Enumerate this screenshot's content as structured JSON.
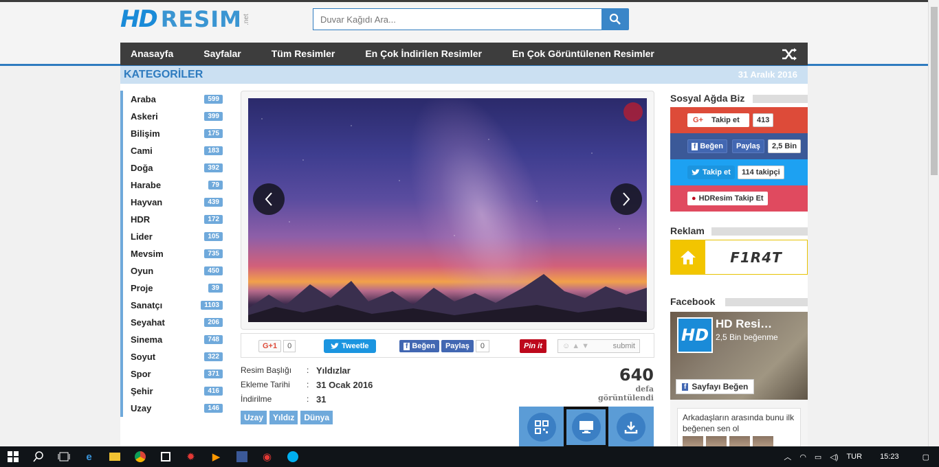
{
  "header": {
    "logo_hd": "HD",
    "logo_text": "RESIM",
    "logo_net": ".net",
    "search_placeholder": "Duvar Kağıdı Ara..."
  },
  "nav": {
    "items": [
      "Anasayfa",
      "Sayfalar",
      "Tüm Resimler",
      "En Çok İndirilen Resimler",
      "En Çok Görüntülenen Resimler"
    ]
  },
  "catbar": {
    "title": "KATEGORİLER",
    "date": "31 Aralık 2016"
  },
  "categories": [
    {
      "name": "Araba",
      "count": "599"
    },
    {
      "name": "Askeri",
      "count": "399"
    },
    {
      "name": "Bilişim",
      "count": "175"
    },
    {
      "name": "Cami",
      "count": "183"
    },
    {
      "name": "Doğa",
      "count": "392"
    },
    {
      "name": "Harabe",
      "count": "79"
    },
    {
      "name": "Hayvan",
      "count": "439"
    },
    {
      "name": "HDR",
      "count": "172"
    },
    {
      "name": "Lider",
      "count": "105"
    },
    {
      "name": "Mevsim",
      "count": "735"
    },
    {
      "name": "Oyun",
      "count": "450"
    },
    {
      "name": "Proje",
      "count": "39"
    },
    {
      "name": "Sanatçı",
      "count": "1103"
    },
    {
      "name": "Seyahat",
      "count": "206"
    },
    {
      "name": "Sinema",
      "count": "748"
    },
    {
      "name": "Soyut",
      "count": "322"
    },
    {
      "name": "Spor",
      "count": "371"
    },
    {
      "name": "Şehir",
      "count": "416"
    },
    {
      "name": "Uzay",
      "count": "146"
    }
  ],
  "share": {
    "gplus": "G+1",
    "gplus_count": "0",
    "tweet": "Tweetle",
    "fb_like": "Beğen",
    "fb_share": "Paylaş",
    "fb_count": "0",
    "pinit": "Pin it",
    "reddit": "submit"
  },
  "info": {
    "rows": [
      {
        "label": "Resim Başlığı",
        "sep": ":",
        "value": "Yıldızlar"
      },
      {
        "label": "Ekleme Tarihi",
        "sep": ":",
        "value": "31 Ocak 2016"
      },
      {
        "label": "İndirilme",
        "sep": ":",
        "value": "31"
      }
    ],
    "tags": [
      "Uzay",
      "Yıldız",
      "Dünya"
    ],
    "views": "640",
    "views_label": "defa görüntülendi"
  },
  "right": {
    "social_title": "Sosyal Ağda Biz",
    "gplus_btn": "Takip et",
    "gplus_icon": "G+",
    "gplus_count": "413",
    "fb_like": "Beğen",
    "fb_share": "Paylaş",
    "fb_count": "2,5 Bin",
    "tw_btn": "Takip et",
    "tw_count": "114 takipçi",
    "pin_btn": "HDResim Takip Et",
    "ad_title": "Reklam",
    "ad_brand": "F1R4T",
    "facebook_title": "Facebook",
    "fb_page_name": "HD Resi…",
    "fb_page_likes": "2,5 Bin beğenme",
    "fb_page_like_btn": "Sayfayı Beğen",
    "fb_friends_text": "Arkadaşların arasında bunu ilk beğenen sen ol"
  },
  "taskbar": {
    "lang": "TUR",
    "time": "15:23"
  },
  "colors": {
    "brand_blue": "#2e7bbf",
    "nav_bg": "#3d3d3d",
    "count_badge": "#6fa9db"
  }
}
